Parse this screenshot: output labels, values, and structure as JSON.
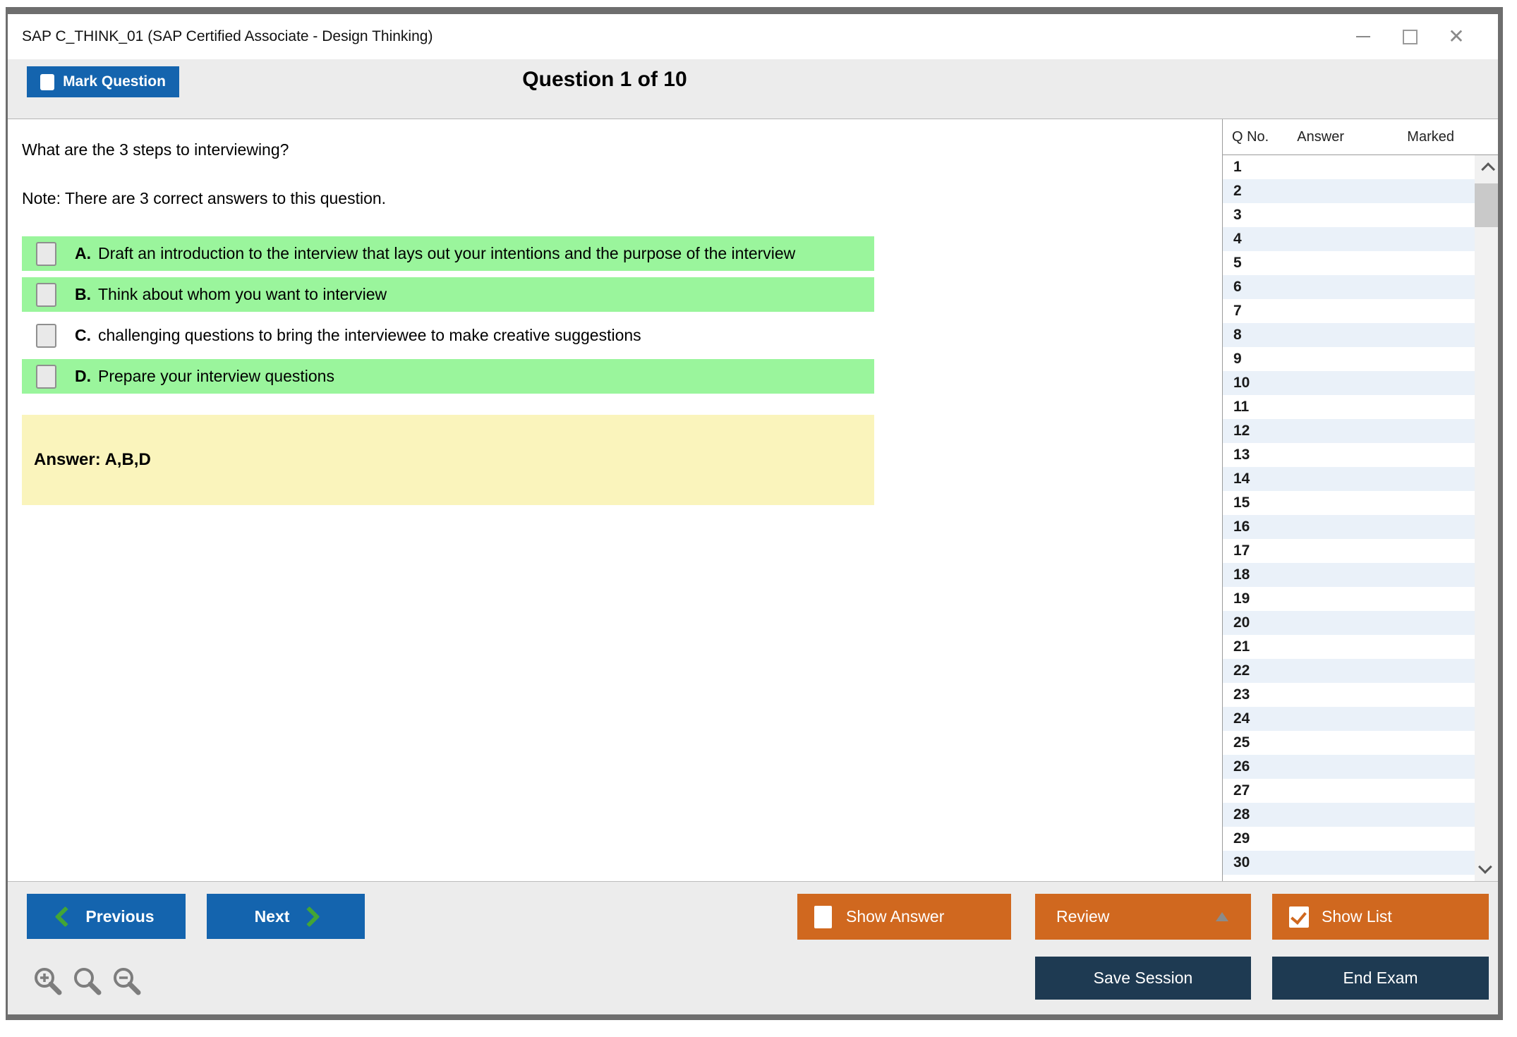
{
  "window": {
    "title": "SAP C_THINK_01 (SAP Certified Associate - Design Thinking)"
  },
  "header": {
    "mark_question_label": "Mark Question",
    "question_counter": "Question 1 of 10"
  },
  "question": {
    "text": "What are the 3 steps to interviewing?",
    "note": "Note: There are 3 correct answers to this question.",
    "options": [
      {
        "letter": "A.",
        "text": "Draft an introduction to the interview that lays out your intentions and the purpose of the interview",
        "highlighted": true
      },
      {
        "letter": "B.",
        "text": "Think about whom you want to interview",
        "highlighted": true
      },
      {
        "letter": "C.",
        "text": "challenging questions to bring the interviewee to make creative suggestions",
        "highlighted": false
      },
      {
        "letter": "D.",
        "text": "Prepare your interview questions",
        "highlighted": true
      }
    ],
    "answer_label": "Answer: A,B,D"
  },
  "sidebar": {
    "columns": [
      "Q No.",
      "Answer",
      "Marked"
    ],
    "rows": [
      "1",
      "2",
      "3",
      "4",
      "5",
      "6",
      "7",
      "8",
      "9",
      "10",
      "11",
      "12",
      "13",
      "14",
      "15",
      "16",
      "17",
      "18",
      "19",
      "20",
      "21",
      "22",
      "23",
      "24",
      "25",
      "26",
      "27",
      "28",
      "29",
      "30"
    ]
  },
  "footer": {
    "previous_label": "Previous",
    "next_label": "Next",
    "show_answer_label": "Show Answer",
    "review_label": "Review",
    "show_list_label": "Show List",
    "save_session_label": "Save Session",
    "end_exam_label": "End Exam"
  },
  "colors": {
    "accent_blue": "#1464AE",
    "accent_orange": "#D0681F",
    "navy": "#1E3A52",
    "highlight_green": "#9AF59C",
    "answer_yellow": "#FAF4BC",
    "chevron_green": "#43A536",
    "alt_row_blue": "#EAF1F9"
  },
  "icons": {
    "minimize": "minimize-icon",
    "maximize": "maximize-icon",
    "close": "close-icon",
    "zoom_in": "zoom-in-icon",
    "zoom_reset": "magnifier-icon",
    "zoom_out": "zoom-out-icon"
  }
}
